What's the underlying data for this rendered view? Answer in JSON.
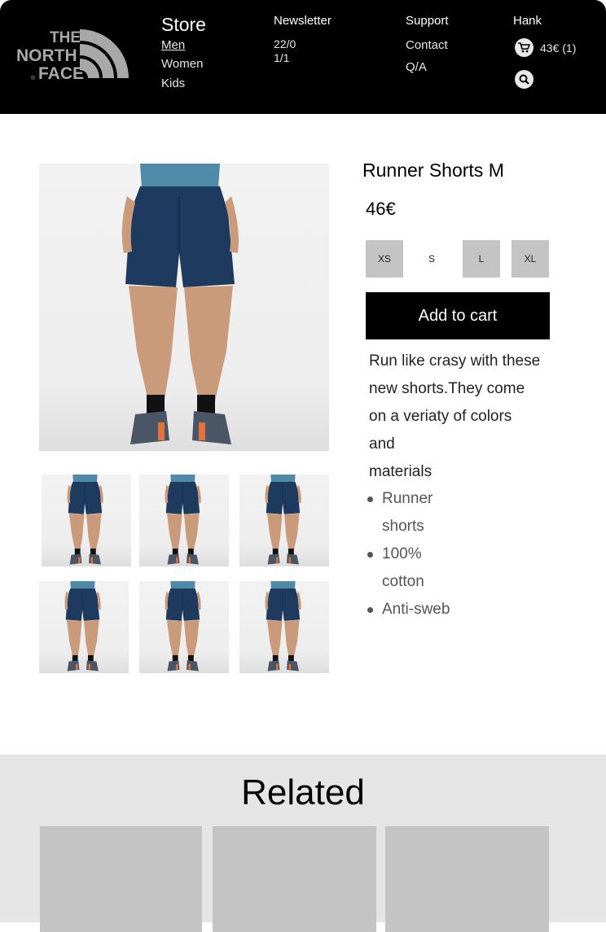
{
  "header": {
    "logo_lines": [
      "THE",
      "NORTH",
      "FACE"
    ],
    "store": {
      "title": "Store",
      "links": [
        "Men",
        "Women",
        "Kids"
      ]
    },
    "newsletter": {
      "title": "Newsletter",
      "line1": "22/0",
      "line2": "1/1"
    },
    "support": {
      "title": "Support",
      "links": [
        "Contact",
        "Q/A"
      ]
    },
    "user": {
      "name": "Hank",
      "cart_summary": "43€ (1)"
    }
  },
  "product": {
    "title": "Runner Shorts M",
    "price": "46€",
    "sizes": [
      "XS",
      "S",
      "L",
      "XL"
    ],
    "selected_size": "S",
    "add_to_cart_label": "Add to cart",
    "description_lines": [
      "Run like crasy with these",
      "new shorts.They come",
      "on a veriaty of colors",
      "and",
      "materials"
    ],
    "features": [
      {
        "line1": "Runner",
        "line2": "shorts"
      },
      {
        "line1": "100%",
        "line2": "cotton"
      },
      {
        "line1": "Anti-sweb",
        "line2": ""
      }
    ]
  },
  "related": {
    "title": "Related"
  },
  "colors": {
    "header_bg": "#000000",
    "size_bg": "#c4c4c4",
    "related_bg": "#e5e5e5",
    "card_bg": "#c4c4c4",
    "shorts": "#1f3a5f",
    "shirt": "#4f8aa8"
  },
  "icons": {
    "cart": "cart-icon",
    "search": "search-icon",
    "logo": "north-face-logo"
  }
}
